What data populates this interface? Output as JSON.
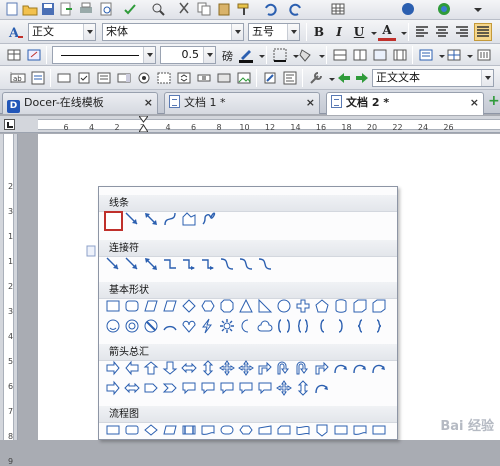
{
  "toolbar2": {
    "style_value": "正文",
    "font_value": "宋体",
    "size_value": "五号",
    "bold_label": "B",
    "italic_label": "I",
    "underline_label": "U",
    "fontcolor_label": "A"
  },
  "toolbar3": {
    "line_width_value": "0.5",
    "line_width_unit": "磅"
  },
  "toolbar4": {
    "style_value": "正文文本"
  },
  "tabs": [
    {
      "label": "Docer-在线模板",
      "close": "×"
    },
    {
      "label": "文档 1 *",
      "close": "×"
    },
    {
      "label": "文档 2 *",
      "close": "×"
    }
  ],
  "new_tab": "+",
  "ruler_h": [
    "6",
    "4",
    "2",
    "2",
    "4",
    "6",
    "8",
    "10",
    "12",
    "14",
    "16",
    "18",
    "20",
    "22",
    "24",
    "26"
  ],
  "ruler_v": [
    "2",
    "3",
    "1",
    "1",
    "2",
    "3",
    "4",
    "5",
    "6",
    "7",
    "8",
    "9"
  ],
  "shapes_panel": {
    "categories": [
      "线条",
      "连接符",
      "基本形状",
      "箭头总汇",
      "流程图"
    ]
  },
  "watermark": "Bai 经验",
  "colors": {
    "accent_green": "#2f9b3a",
    "selection_red": "#c0302b",
    "shape_blue": "#2b5fb0"
  }
}
